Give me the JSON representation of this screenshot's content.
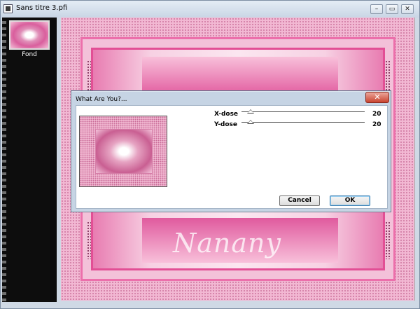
{
  "window": {
    "title": "Sans titre 3.pfi",
    "minimize_icon": "minimize-icon",
    "maximize_icon": "restore-icon",
    "close_icon": "close-icon"
  },
  "layers": {
    "items": [
      {
        "label": "Fond"
      }
    ]
  },
  "canvas": {
    "watermark": "Nanany"
  },
  "dialog": {
    "title": "What Are You?...",
    "close_label": "✕",
    "params": [
      {
        "label": "X-dose",
        "value": "20"
      },
      {
        "label": "Y-dose",
        "value": "20"
      }
    ],
    "cancel_label": "Cancel",
    "ok_label": "OK"
  }
}
